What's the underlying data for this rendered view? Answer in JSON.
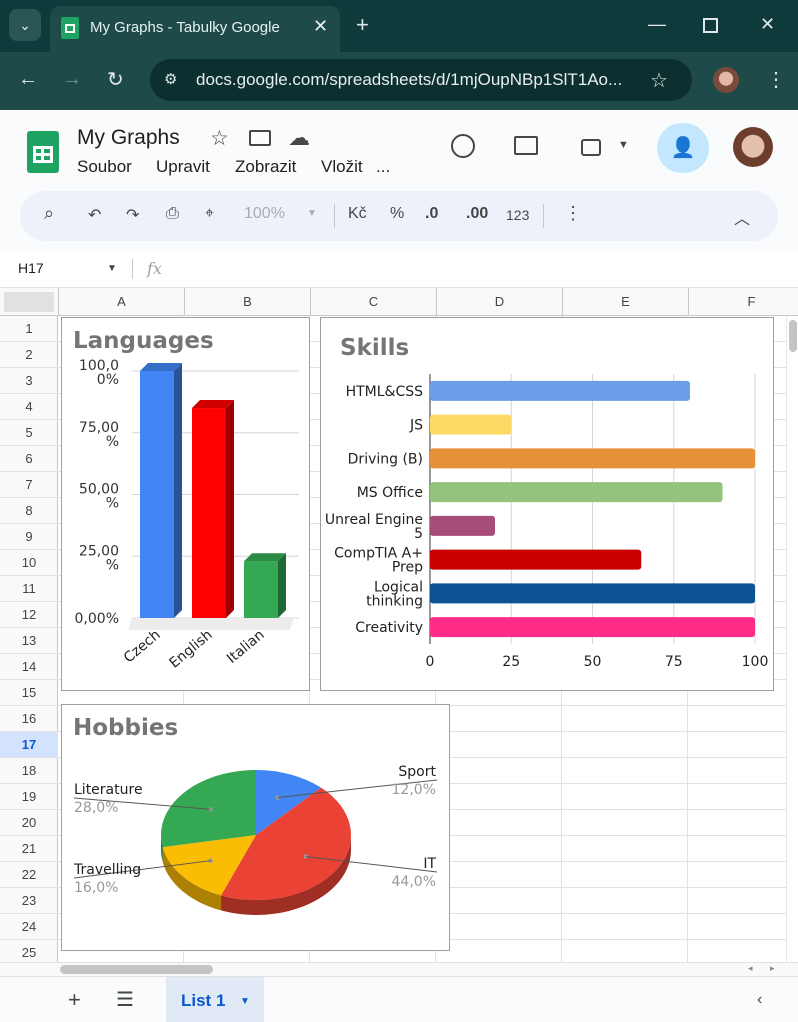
{
  "browser": {
    "tab_title": "My Graphs - Tabulky Google",
    "url": "docs.google.com/spreadsheets/d/1mjOupNBp1SlT1Ao..."
  },
  "doc": {
    "title": "My Graphs",
    "menus": [
      "Soubor",
      "Upravit",
      "Zobrazit",
      "Vložit",
      "..."
    ]
  },
  "toolbar": {
    "zoom": "100%",
    "currency": "Kč",
    "percent": "%",
    "dec_less": ".0",
    "dec_more": ".00",
    "number_format": "123"
  },
  "formula": {
    "cell_ref": "H17",
    "fx": "fx"
  },
  "columns": [
    "A",
    "B",
    "C",
    "D",
    "E",
    "F"
  ],
  "rows": [
    "1",
    "2",
    "3",
    "4",
    "5",
    "6",
    "7",
    "8",
    "9",
    "10",
    "11",
    "12",
    "13",
    "14",
    "15",
    "16",
    "17",
    "18",
    "19",
    "20",
    "21",
    "22",
    "23",
    "24",
    "25"
  ],
  "selected_row": "17",
  "sheet": {
    "tab_label": "List 1"
  },
  "chart_data": [
    {
      "type": "bar",
      "title": "Languages",
      "categories": [
        "Czech",
        "English",
        "Italian"
      ],
      "values": [
        100,
        85,
        23
      ],
      "ytick_labels": [
        "0,00%",
        "25,00 %",
        "50,00 %",
        "75,00 %",
        "100,0 0%"
      ],
      "ylim": [
        0,
        100
      ],
      "colors": [
        "#4285f4",
        "#ff0000",
        "#34a853"
      ]
    },
    {
      "type": "bar",
      "orientation": "horizontal",
      "title": "Skills",
      "categories": [
        "HTML&CSS",
        "JS",
        "Driving (B)",
        "MS Office",
        "Unreal Engine 5",
        "CompTIA A+ Prep",
        "Logical thinking",
        "Creativity"
      ],
      "values": [
        80,
        25,
        100,
        90,
        20,
        65,
        100,
        100
      ],
      "xticks": [
        "0",
        "25",
        "50",
        "75",
        "100"
      ],
      "xlim": [
        0,
        100
      ],
      "colors": [
        "#6d9eeb",
        "#ffd966",
        "#e69138",
        "#93c47d",
        "#a64d79",
        "#cc0000",
        "#0b5394",
        "#ff2d87"
      ]
    },
    {
      "type": "pie",
      "title": "Hobbies",
      "slices": [
        {
          "label": "Sport",
          "value": "12,0%",
          "pct": 12,
          "color": "#4285f4"
        },
        {
          "label": "IT",
          "value": "44,0%",
          "pct": 44,
          "color": "#ea4335"
        },
        {
          "label": "Travelling",
          "value": "16,0%",
          "pct": 16,
          "color": "#fbbc04"
        },
        {
          "label": "Literature",
          "value": "28,0%",
          "pct": 28,
          "color": "#34a853"
        }
      ]
    }
  ]
}
